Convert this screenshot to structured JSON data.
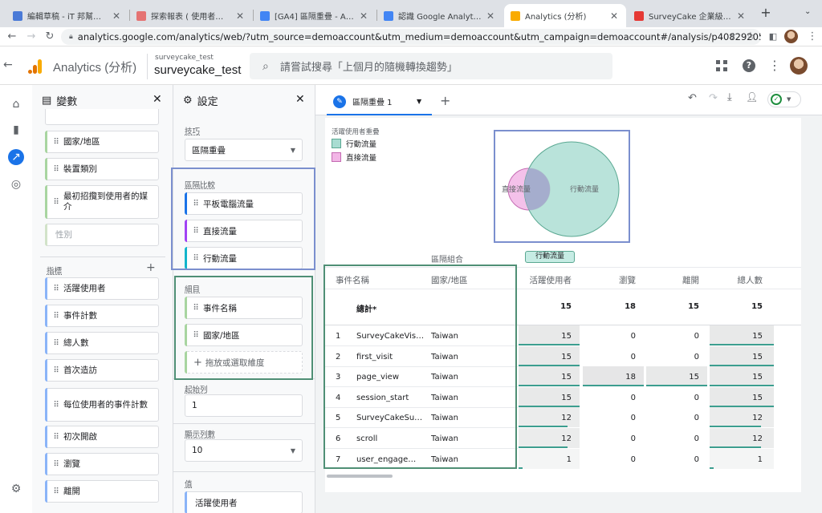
{
  "browser": {
    "tabs": [
      {
        "title": "編輯草稿 - iT 邦幫忙::一起幫",
        "fav": "#4a7ad7"
      },
      {
        "title": "探索報表 ( 使用者多層檢視 )",
        "fav": "#e57373"
      },
      {
        "title": "[GA4] 區隔重疊 - Analytics 說",
        "fav": "#4285f4"
      },
      {
        "title": "認識 Google Analytics (分析)",
        "fav": "#4285f4"
      },
      {
        "title": "Analytics (分析)",
        "fav": "#f9ab00"
      },
      {
        "title": "SurveyCake 企業級的雲端問卷",
        "fav": "#e53935"
      }
    ],
    "url": "analytics.google.com/analytics/web/?utm_source=demoaccount&utm_medium=demoaccount&utm_campaign=demoaccount#/analysis/p408292050/edit/YdEnPP7BT5..."
  },
  "ga": {
    "app_name": "Analytics (分析)",
    "account_small": "surveycake_test",
    "account_big": "surveycake_test",
    "search_placeholder": "請嘗試搜尋「上個月的隨機轉換趨勢」"
  },
  "variables": {
    "title": "變數",
    "dimension_chips": [
      "國家/地區",
      "裝置類別",
      "最初招攬到使用者的媒介",
      "性別"
    ],
    "metrics_label": "指標",
    "metric_chips": [
      "活躍使用者",
      "事件計數",
      "總人數",
      "首次造訪",
      "每位使用者的事件計數",
      "初次開啟",
      "瀏覽",
      "離開"
    ]
  },
  "settings": {
    "title": "設定",
    "technique_label": "技巧",
    "technique_value": "區隔重疊",
    "segment_compare_label": "區隔比較",
    "segments": [
      {
        "label": "平板電腦流量",
        "color": "#1a73e8"
      },
      {
        "label": "直接流量",
        "color": "#a142f4"
      },
      {
        "label": "行動流量",
        "color": "#12b5cb"
      }
    ],
    "breakdown_label": "細目",
    "breakdowns": [
      "事件名稱",
      "國家/地區"
    ],
    "add_dimension": "拖放或選取維度",
    "start_row_label": "起始列",
    "start_row_value": "1",
    "show_rows_label": "顯示列數",
    "show_rows_value": "10",
    "values_label": "值",
    "values_chip": "活躍使用者"
  },
  "canvas": {
    "tab_label": "區隔重疊 1",
    "venn": {
      "title": "活躍使用者重疊",
      "legend": [
        {
          "label": "行動流量",
          "color": "#a8dcd1"
        },
        {
          "label": "直接流量",
          "color": "#f2b6e6"
        }
      ],
      "label_small": "直接流量",
      "label_big": "行動流量"
    },
    "table": {
      "segment_combo_label": "區隔組合",
      "segment_chip": "行動流量",
      "headers": [
        "事件名稱",
        "國家/地區",
        "活躍使用者",
        "瀏覽",
        "離開",
        "總人數"
      ],
      "total_label": "總計*",
      "totals": [
        "15",
        "18",
        "15",
        "15"
      ],
      "rows": [
        {
          "n": "1",
          "event": "SurveyCakeVis…",
          "country": "Taiwan",
          "v": [
            "15",
            "0",
            "0",
            "15"
          ]
        },
        {
          "n": "2",
          "event": "first_visit",
          "country": "Taiwan",
          "v": [
            "15",
            "0",
            "0",
            "15"
          ]
        },
        {
          "n": "3",
          "event": "page_view",
          "country": "Taiwan",
          "v": [
            "15",
            "18",
            "15",
            "15"
          ]
        },
        {
          "n": "4",
          "event": "session_start",
          "country": "Taiwan",
          "v": [
            "15",
            "0",
            "0",
            "15"
          ]
        },
        {
          "n": "5",
          "event": "SurveyCakeSu…",
          "country": "Taiwan",
          "v": [
            "12",
            "0",
            "0",
            "12"
          ]
        },
        {
          "n": "6",
          "event": "scroll",
          "country": "Taiwan",
          "v": [
            "12",
            "0",
            "0",
            "12"
          ]
        },
        {
          "n": "7",
          "event": "user_engage…",
          "country": "Taiwan",
          "v": [
            "1",
            "0",
            "0",
            "1"
          ]
        }
      ]
    }
  }
}
